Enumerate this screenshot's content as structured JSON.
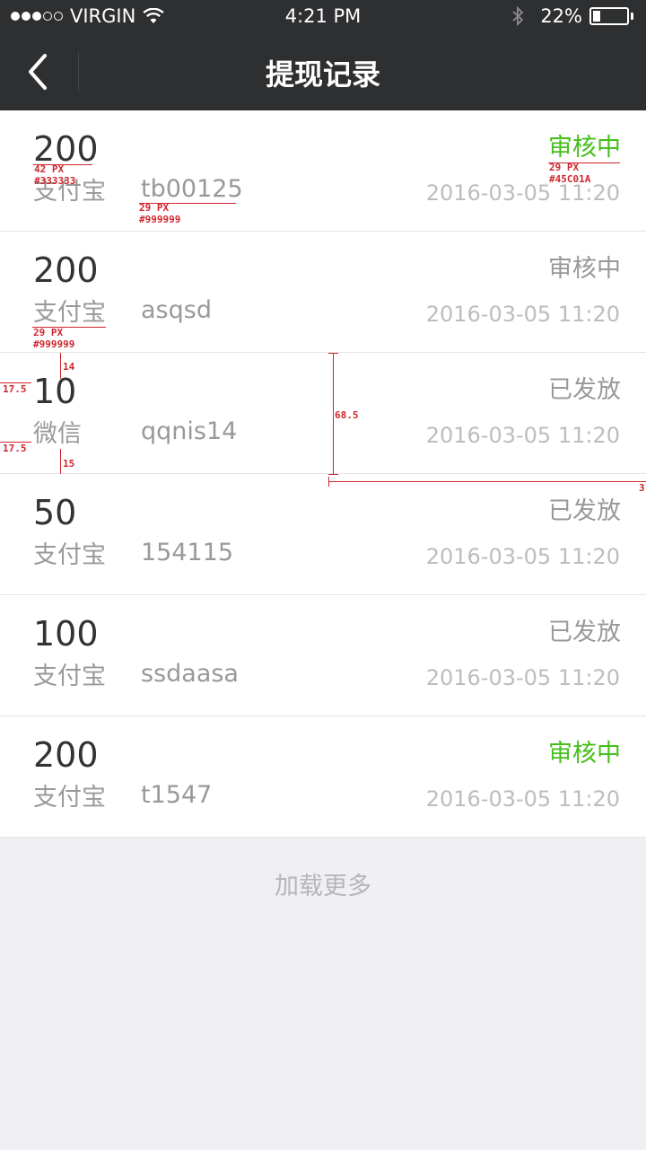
{
  "status_bar": {
    "carrier": "VIRGIN",
    "time": "4:21 PM",
    "battery": "22%",
    "battery_level": 0.22,
    "signal_bars_filled": 3,
    "signal_bars_total": 5
  },
  "nav": {
    "title": "提现记录",
    "back_icon": "chevron-left-icon"
  },
  "colors": {
    "status_pending": "#45C01A",
    "status_done": "#999999",
    "amount": "#333333",
    "secondary": "#999999"
  },
  "records": [
    {
      "amount": "200",
      "channel": "支付宝",
      "account": "tb00125",
      "status": "审核中",
      "status_type": "pending",
      "time": "2016-03-05 11:20"
    },
    {
      "amount": "200",
      "channel": "支付宝",
      "account": "asqsd",
      "status": "审核中",
      "status_type": "done",
      "time": "2016-03-05 11:20"
    },
    {
      "amount": "10",
      "channel": "微信",
      "account": "qqnis14",
      "status": "已发放",
      "status_type": "done",
      "time": "2016-03-05 11:20"
    },
    {
      "amount": "50",
      "channel": "支付宝",
      "account": "154115",
      "status": "已发放",
      "status_type": "done",
      "time": "2016-03-05 11:20"
    },
    {
      "amount": "100",
      "channel": "支付宝",
      "account": "ssdaasa",
      "status": "已发放",
      "status_type": "done",
      "time": "2016-03-05 11:20"
    },
    {
      "amount": "200",
      "channel": "支付宝",
      "account": "t1547",
      "status": "审核中",
      "status_type": "pending",
      "time": "2016-03-05 11:20"
    }
  ],
  "load_more": "加载更多",
  "annotations": {
    "amount_size": "42 PX",
    "amount_color": "#333333",
    "account_size": "29 PX",
    "account_color": "#999999",
    "status_size": "29 PX",
    "status_color": "#45C01A",
    "channel_size": "29 PX",
    "channel_color": "#999999",
    "gap_top": "14",
    "gap_bottom": "15",
    "left_pad_1": "17.5",
    "left_pad_2": "17.5",
    "row_height": "68.5",
    "right_width": "3"
  }
}
